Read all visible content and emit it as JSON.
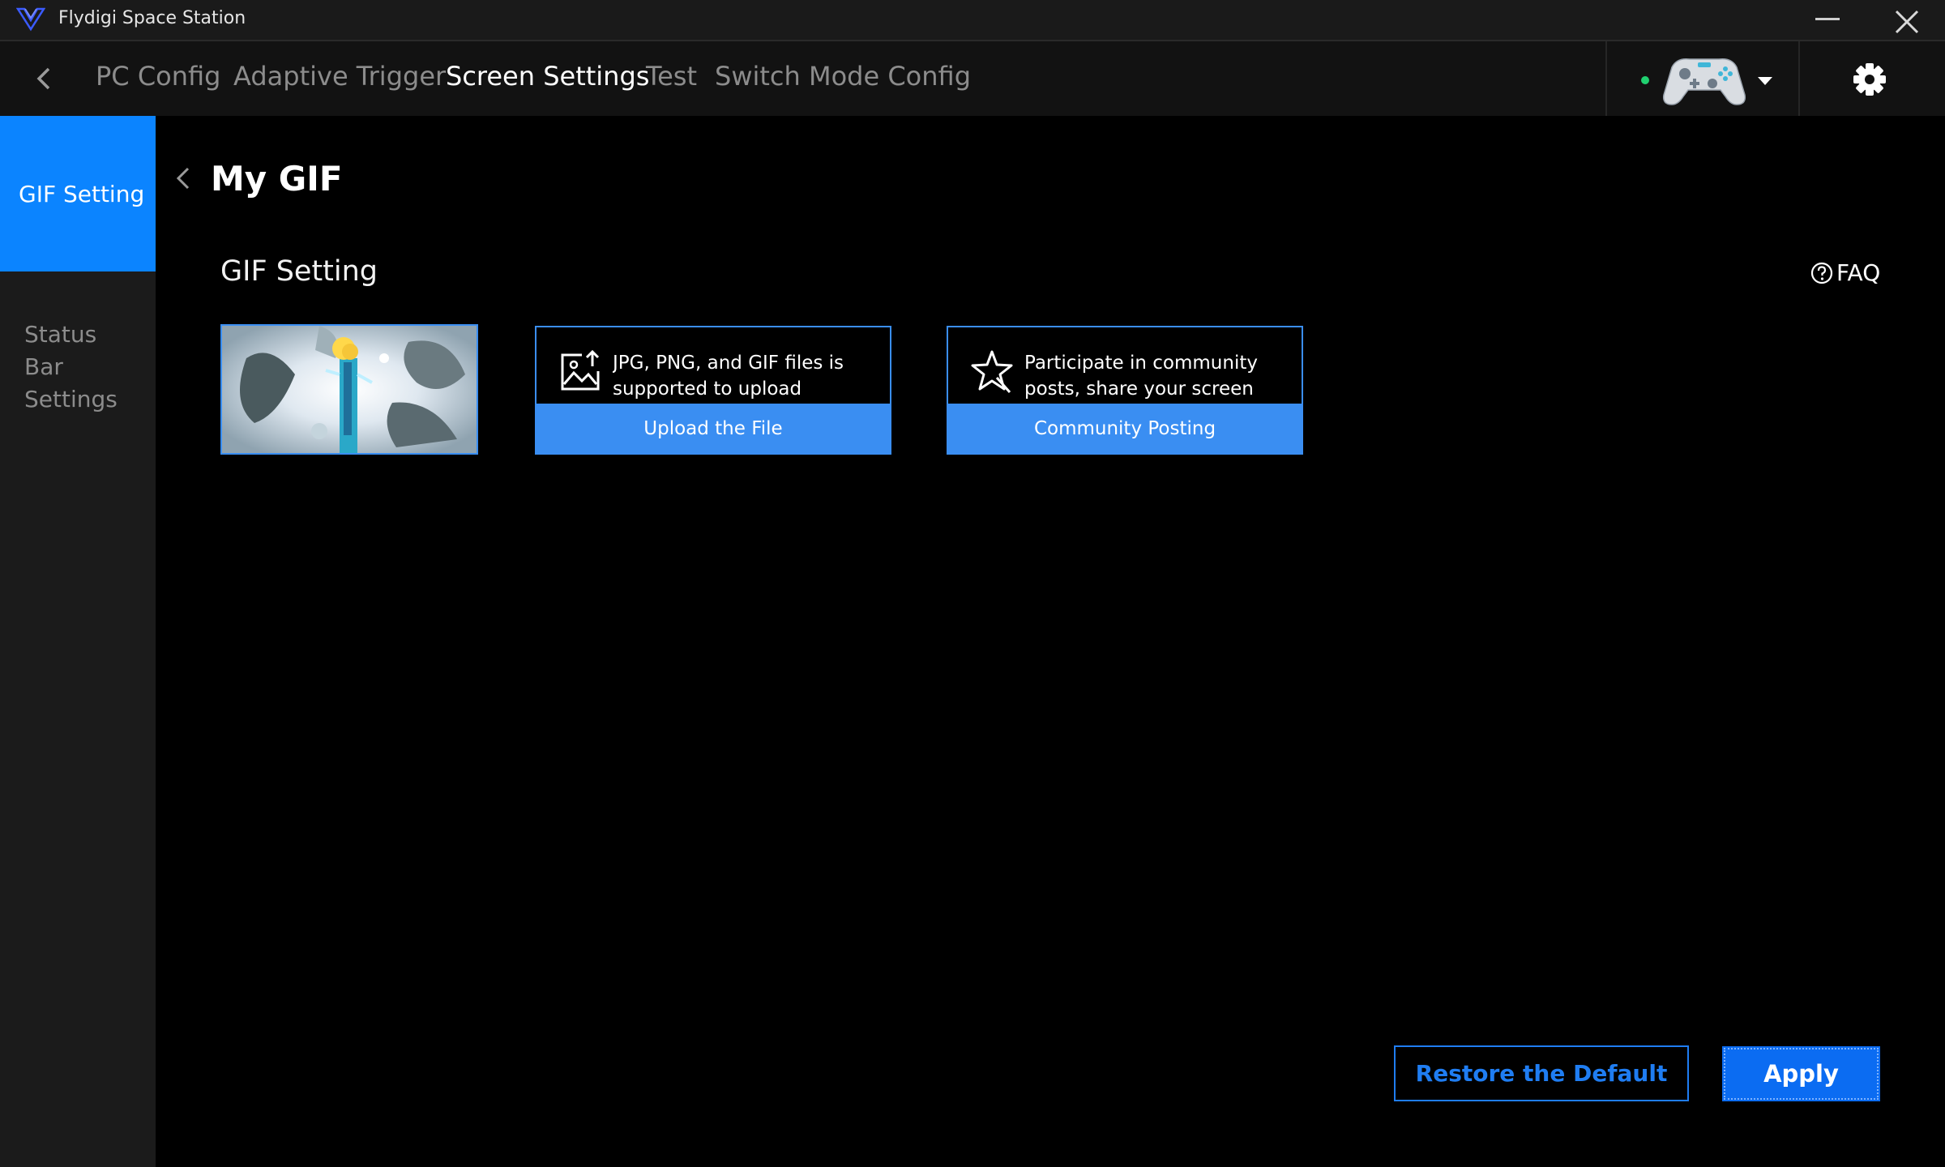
{
  "window": {
    "title": "Flydigi Space Station",
    "logo": "flydigi-logo-icon"
  },
  "nav": {
    "tabs": [
      {
        "label": "PC Config"
      },
      {
        "label": "Adaptive Trigger"
      },
      {
        "label": "Screen Settings",
        "active": true
      },
      {
        "label": "Test"
      },
      {
        "label": "Switch Mode Config"
      }
    ],
    "device_status_color": "#20d070"
  },
  "sidebar": {
    "items": [
      {
        "label": "GIF Setting",
        "active": true
      },
      {
        "label": "Status Bar Settings"
      }
    ]
  },
  "main": {
    "page_title": "My GIF",
    "section_title": "GIF Setting",
    "faq_label": "FAQ",
    "cards": [
      {
        "description": "JPG, PNG, and GIF files is supported to upload",
        "button_label": "Upload the File",
        "icon": "image-upload-icon"
      },
      {
        "description": "Participate in community posts, share your screen",
        "button_label": "Community Posting",
        "icon": "star-share-icon"
      }
    ]
  },
  "footer": {
    "restore_label": "Restore the Default",
    "apply_label": "Apply"
  },
  "colors": {
    "accent": "#0b84ff",
    "card_blue": "#3a8ef2",
    "apply_blue": "#0b6cf2"
  }
}
